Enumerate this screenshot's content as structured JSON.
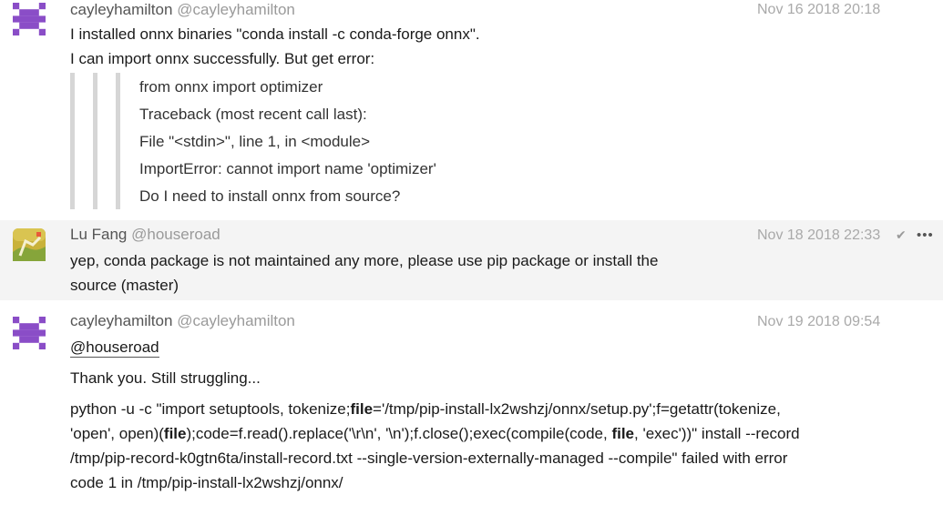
{
  "messages": [
    {
      "author": "cayleyhamilton",
      "handle": "@cayleyhamilton",
      "timestamp": "Nov 16 2018 20:18",
      "lines": [
        "I installed onnx binaries \"conda install -c conda-forge onnx\".",
        "I can import onnx successfully. But get error:"
      ],
      "quote": [
        "from onnx import optimizer",
        "Traceback (most recent call last):",
        "File \"<stdin>\", line 1, in <module>",
        "ImportError: cannot import name 'optimizer'",
        "Do I need to install onnx from source?"
      ]
    },
    {
      "author": "Lu Fang",
      "handle": "@houseroad",
      "timestamp": "Nov 18 2018 22:33",
      "lines": [
        "yep, conda package is not maintained any more, please use pip package or install the",
        "source (master)"
      ]
    },
    {
      "author": "cayleyhamilton",
      "handle": "@cayleyhamilton",
      "timestamp": "Nov 19 2018 09:54",
      "mention": "@houseroad",
      "thanks": "Thank you. Still struggling...",
      "code_lines": [
        [
          "python -u -c \"import setuptools, tokenize;",
          "file",
          "='/tmp/pip-install-lx2wshzj/onnx/setup.py';f=getattr(tokenize,"
        ],
        [
          "'open', open)(",
          "file",
          ");code=f.read().replace('\\r\\n', '\\n');f.close();exec(compile(code, ",
          "file",
          ", 'exec'))\" install --record"
        ],
        [
          "/tmp/pip-record-k0gtn6ta/install-record.txt --single-version-externally-managed --compile\" failed with error"
        ],
        [
          "code 1 in /tmp/pip-install-lx2wshzj/onnx/"
        ]
      ]
    }
  ],
  "icons": {
    "read_mark": "checkmark-icon",
    "more_menu": "ellipsis-icon"
  },
  "colors": {
    "avatar_purple": "#8a4dc7",
    "hover_bg": "#f4f4f4"
  }
}
